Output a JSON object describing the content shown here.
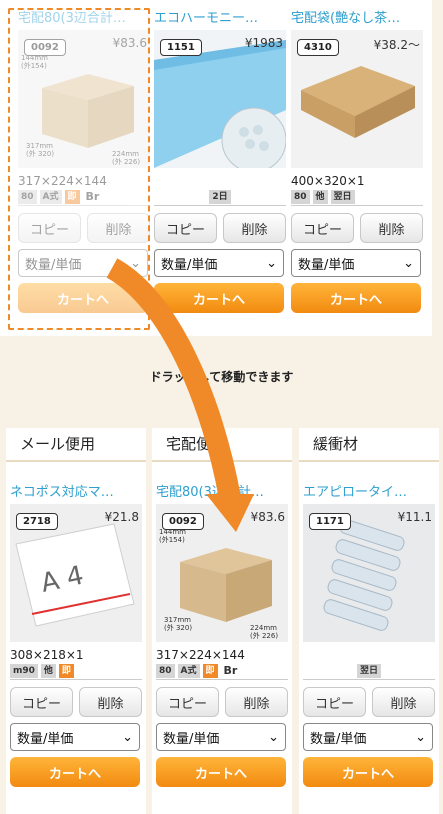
{
  "hint_text": "ドラッグして移動できます",
  "top_cards": [
    {
      "title": "宅配80(3辺合計…",
      "code": "0092",
      "price": "¥83.6",
      "size": "317×224×144",
      "tags": [
        "80",
        "A式",
        "即",
        "Br"
      ],
      "copy": "コピー",
      "delete": "削除",
      "select": "数量/単価",
      "cart": "カートへ"
    },
    {
      "title": "エコハーモニー…",
      "code": "1151",
      "price": "¥1983",
      "size": "",
      "tags": [
        "2日"
      ],
      "copy": "コピー",
      "delete": "削除",
      "select": "数量/単価",
      "cart": "カートへ"
    },
    {
      "title": "宅配袋(艶なし茶…",
      "code": "4310",
      "price": "¥38.2～",
      "size": "400×320×1",
      "tags": [
        "80",
        "他",
        "翌日"
      ],
      "copy": "コピー",
      "delete": "削除",
      "select": "数量/単価",
      "cart": "カートへ"
    }
  ],
  "columns": [
    {
      "header": "メール便用",
      "card": {
        "title": "ネコポス対応マ…",
        "code": "2718",
        "price": "¥21.8",
        "size": "308×218×1",
        "tags": [
          "m90",
          "他",
          "即"
        ],
        "copy": "コピー",
        "delete": "削除",
        "select": "数量/単価",
        "cart": "カートへ"
      }
    },
    {
      "header": "宅配便用",
      "card": {
        "title": "宅配80(3辺合計…",
        "code": "0092",
        "price": "¥83.6",
        "size": "317×224×144",
        "tags": [
          "80",
          "A式",
          "即",
          "Br"
        ],
        "copy": "コピー",
        "delete": "削除",
        "select": "数量/単価",
        "cart": "カートへ"
      }
    },
    {
      "header": "緩衝材",
      "card": {
        "title": "エアピロータイ…",
        "code": "1171",
        "price": "¥11.1",
        "size": "",
        "tags": [
          "翌日"
        ],
        "copy": "コピー",
        "delete": "削除",
        "select": "数量/単価",
        "cart": "カートへ"
      }
    }
  ],
  "box_dims": {
    "h": "144mm",
    "h_out": "(外154)",
    "w": "317mm",
    "w_out": "(外 320)",
    "d": "224mm",
    "d_out": "(外 226)"
  },
  "a4_label": "A 4",
  "accent": "#f08a28",
  "link_color": "#2e9fd0"
}
